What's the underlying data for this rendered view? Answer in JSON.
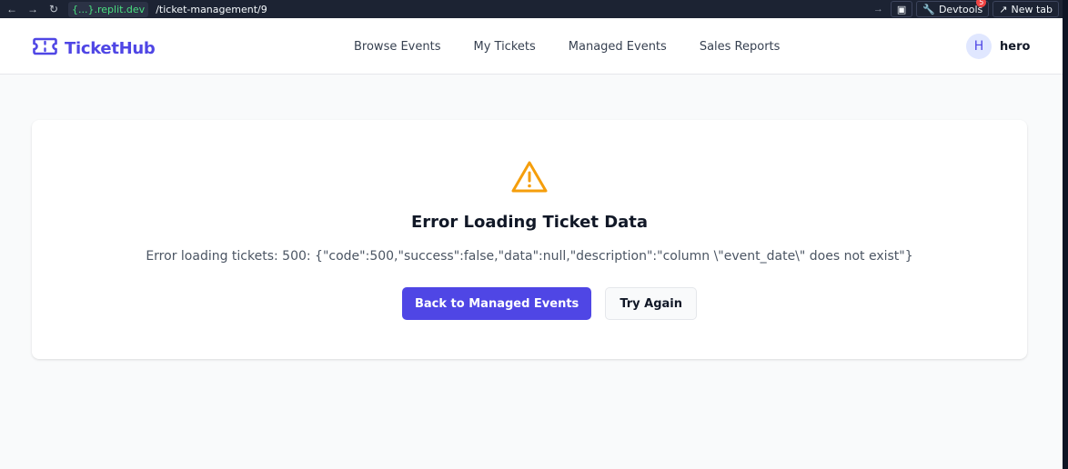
{
  "browser": {
    "url_host": "{...}.replit.dev",
    "url_path": "/ticket-management/9",
    "devtools_label": "Devtools",
    "devtools_badge": "5",
    "new_tab_label": "New tab"
  },
  "header": {
    "brand": "TicketHub",
    "brand_color": "#4f46e5",
    "nav": [
      {
        "label": "Browse Events"
      },
      {
        "label": "My Tickets"
      },
      {
        "label": "Managed Events"
      },
      {
        "label": "Sales Reports"
      }
    ],
    "user": {
      "initial": "H",
      "name": "hero"
    }
  },
  "error": {
    "icon": "warning-triangle-icon",
    "icon_color": "#f59e0b",
    "title": "Error Loading Ticket Data",
    "message": "Error loading tickets: 500: {\"code\":500,\"success\":false,\"data\":null,\"description\":\"column \\\"event_date\\\" does not exist\"}",
    "primary_button": "Back to Managed Events",
    "secondary_button": "Try Again"
  }
}
